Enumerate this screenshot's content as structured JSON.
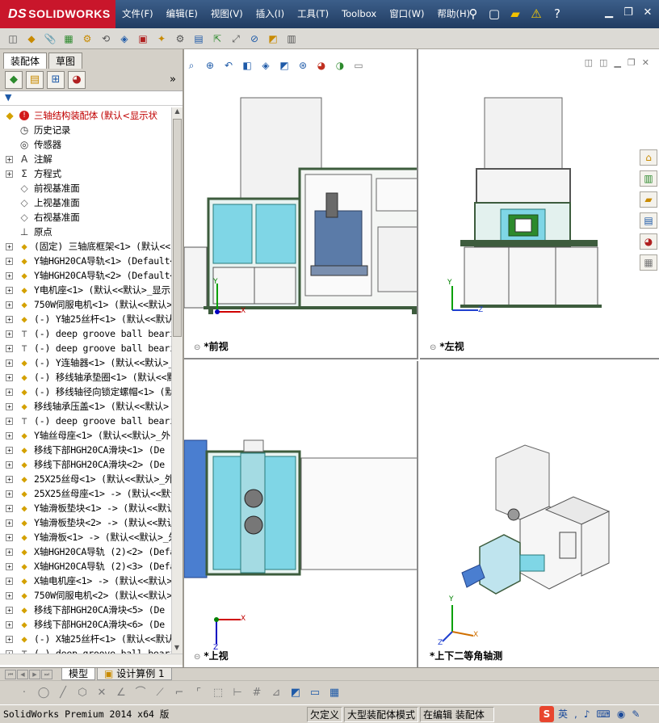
{
  "app": {
    "logo_prefix": "DS",
    "logo_text": "SOLIDWORKS"
  },
  "menu": [
    "文件(F)",
    "编辑(E)",
    "视图(V)",
    "插入(I)",
    "工具(T)",
    "Toolbox",
    "窗口(W)",
    "帮助(H)"
  ],
  "left_tabs": {
    "assembly": "装配体",
    "sketch": "草图"
  },
  "tree_root": "三轴结构装配体 (默认<显示状",
  "tree": [
    {
      "label": "历史记录",
      "icon": "history-icon",
      "expand": false,
      "cn": true
    },
    {
      "label": "传感器",
      "icon": "sensor-icon",
      "expand": false,
      "cn": true
    },
    {
      "label": "注解",
      "icon": "annotation-icon",
      "expand": true,
      "cn": true
    },
    {
      "label": "方程式",
      "icon": "equation-icon",
      "expand": true,
      "cn": true
    },
    {
      "label": "前视基准面",
      "icon": "plane-icon",
      "expand": false,
      "cn": true
    },
    {
      "label": "上视基准面",
      "icon": "plane-icon",
      "expand": false,
      "cn": true
    },
    {
      "label": "右视基准面",
      "icon": "plane-icon",
      "expand": false,
      "cn": true
    },
    {
      "label": "原点",
      "icon": "origin-icon",
      "expand": false,
      "cn": true
    },
    {
      "label": "(固定) 三轴底框架<1> (默认<<",
      "icon": "part-icon",
      "expand": true
    },
    {
      "label": "Y轴HGH20CA导轨<1> (Default<<",
      "icon": "part-icon",
      "expand": true
    },
    {
      "label": "Y轴HGH20CA导轨<2> (Default<<",
      "icon": "part-icon",
      "expand": true
    },
    {
      "label": "Y电机座<1> (默认<<默认>_显示",
      "icon": "part-icon",
      "expand": true
    },
    {
      "label": "750W伺服电机<1> (默认<<默认>",
      "icon": "part-icon",
      "expand": true
    },
    {
      "label": "(-) Y轴25丝杆<1> (默认<<默认",
      "icon": "part-icon",
      "expand": true
    },
    {
      "label": "(-) deep groove ball bearing",
      "icon": "bolt-icon",
      "expand": true
    },
    {
      "label": "(-) deep groove ball bearing",
      "icon": "bolt-icon",
      "expand": true
    },
    {
      "label": "(-) Y连轴器<1> (默认<<默认>_",
      "icon": "part-icon",
      "expand": true
    },
    {
      "label": "(-) 移线轴承垫圈<1> (默认<<默",
      "icon": "part-icon",
      "expand": true
    },
    {
      "label": "(-) 移线轴径向锁定螺帽<1> (默",
      "icon": "part-icon",
      "expand": true
    },
    {
      "label": "移线轴承压盖<1> (默认<<默认>",
      "icon": "part-icon",
      "expand": true
    },
    {
      "label": "(-) deep groove ball bearing",
      "icon": "bolt-icon",
      "expand": true
    },
    {
      "label": "Y轴丝母座<1> (默认<<默认>_外",
      "icon": "part-icon",
      "expand": true
    },
    {
      "label": "移线下部HGH20CA滑块<1> (De",
      "icon": "part-icon",
      "expand": true
    },
    {
      "label": "移线下部HGH20CA滑块<2> (De",
      "icon": "part-icon",
      "expand": true
    },
    {
      "label": "25X25丝母<1> (默认<<默认>_外",
      "icon": "part-icon",
      "expand": true
    },
    {
      "label": "25X25丝母座<1> -> (默认<<默认",
      "icon": "part-icon",
      "expand": true
    },
    {
      "label": "Y轴滑板垫块<1> -> (默认<<默认",
      "icon": "part-icon",
      "expand": true
    },
    {
      "label": "Y轴滑板垫块<2> -> (默认<<默认",
      "icon": "part-icon",
      "expand": true
    },
    {
      "label": "Y轴滑板<1> -> (默认<<默认>_外",
      "icon": "part-icon",
      "expand": true
    },
    {
      "label": "X轴HGH20CA导轨 (2)<2> (Defau",
      "icon": "part-icon",
      "expand": true
    },
    {
      "label": "X轴HGH20CA导轨 (2)<3> (Defau",
      "icon": "part-icon",
      "expand": true
    },
    {
      "label": "X轴电机座<1> -> (默认<<默认>",
      "icon": "part-icon",
      "expand": true
    },
    {
      "label": "750W伺服电机<2> (默认<<默认>",
      "icon": "part-icon",
      "expand": true
    },
    {
      "label": "移线下部HGH20CA滑块<5> (De",
      "icon": "part-icon",
      "expand": true
    },
    {
      "label": "移线下部HGH20CA滑块<6> (De",
      "icon": "part-icon",
      "expand": true
    },
    {
      "label": "(-) X轴25丝杆<1> (默认<<默认",
      "icon": "part-icon",
      "expand": true
    },
    {
      "label": "(-) deep groove ball bearing",
      "icon": "bolt-icon",
      "expand": true
    }
  ],
  "viewports": {
    "front": "*前视",
    "left": "*左视",
    "top": "*上视",
    "iso": "*上下二等角轴测"
  },
  "axes": {
    "x": "X",
    "y": "Y",
    "z": "Z"
  },
  "bottom_tabs": {
    "model": "模型",
    "study": "设计算例 1"
  },
  "status": {
    "version": "SolidWorks Premium 2014 x64 版",
    "underdefined": "欠定义",
    "large_assembly": "大型装配体模式",
    "editing": "在编辑 装配体",
    "ime": "英"
  },
  "colors": {
    "brand_red": "#c9162b",
    "title_blue": "#2a4a75",
    "frame_green": "#3d5c3d",
    "glass_cyan": "#7fd6e6"
  }
}
